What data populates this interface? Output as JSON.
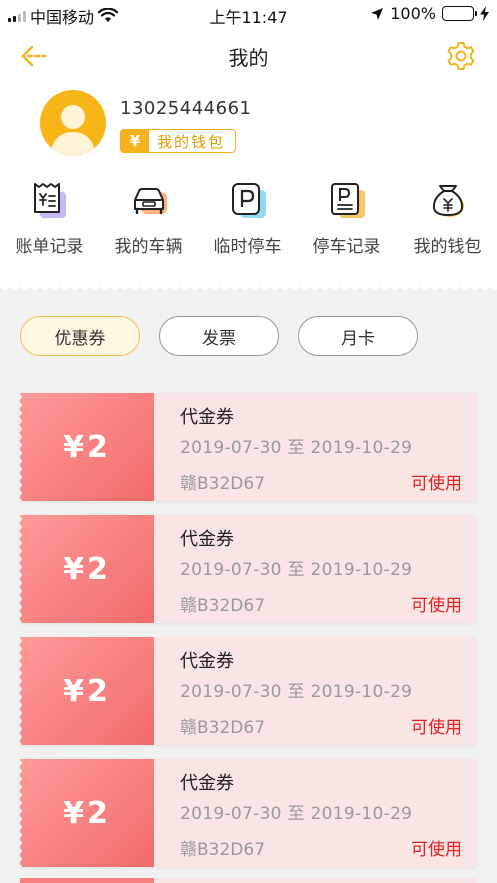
{
  "status_bar": {
    "carrier": "中国移动",
    "time": "上午11:47",
    "battery": "100%",
    "battery_level": 1.0
  },
  "header": {
    "title": "我的",
    "back_icon": "back-arrow-icon",
    "settings_icon": "gear-icon"
  },
  "profile": {
    "phone": "13025444661",
    "wallet_badge": {
      "symbol": "¥",
      "label": "我的钱包"
    }
  },
  "menu": [
    {
      "label": "账单记录",
      "icon": "bill-icon"
    },
    {
      "label": "我的车辆",
      "icon": "car-icon"
    },
    {
      "label": "临时停车",
      "icon": "parking-icon"
    },
    {
      "label": "停车记录",
      "icon": "parking-record-icon"
    },
    {
      "label": "我的钱包",
      "icon": "money-bag-icon"
    }
  ],
  "tabs": [
    {
      "label": "优惠券",
      "active": true
    },
    {
      "label": "发票",
      "active": false
    },
    {
      "label": "月卡",
      "active": false
    }
  ],
  "coupons": [
    {
      "amount": "¥2",
      "title": "代金券",
      "date_range": "2019-07-30 至 2019-10-29",
      "plate": "赣B32D67",
      "status": "可使用"
    },
    {
      "amount": "¥2",
      "title": "代金券",
      "date_range": "2019-07-30 至 2019-10-29",
      "plate": "赣B32D67",
      "status": "可使用"
    },
    {
      "amount": "¥2",
      "title": "代金券",
      "date_range": "2019-07-30 至 2019-10-29",
      "plate": "赣B32D67",
      "status": "可使用"
    },
    {
      "amount": "¥2",
      "title": "代金券",
      "date_range": "2019-07-30 至 2019-10-29",
      "plate": "赣B32D67",
      "status": "可使用"
    }
  ],
  "colors": {
    "accent": "#f4b31c",
    "coupon_left": "#f26b6b",
    "coupon_bg": "#fbe4e4",
    "status_red": "#e12222"
  }
}
